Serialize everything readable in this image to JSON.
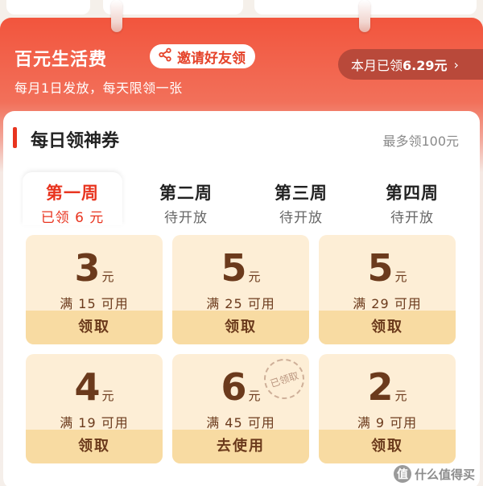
{
  "banner": {
    "title": "百元生活费",
    "invite_label": "邀请好友领",
    "subtitle": "每月1日发放，每天限领一张",
    "monthly_prefix": "本月已领",
    "monthly_amount": "6.29元",
    "monthly_chevron": "›"
  },
  "section": {
    "title": "每日领神券",
    "max_text": "最多领100元"
  },
  "tabs": [
    {
      "label": "第一周",
      "status": "已领 6 元",
      "active": true
    },
    {
      "label": "第二周",
      "status": "待开放",
      "active": false
    },
    {
      "label": "第三周",
      "status": "待开放",
      "active": false
    },
    {
      "label": "第四周",
      "status": "待开放",
      "active": false
    }
  ],
  "coupons": [
    {
      "value": "3",
      "unit": "元",
      "condition": "满 15 可用",
      "action": "领取"
    },
    {
      "value": "5",
      "unit": "元",
      "condition": "满 25 可用",
      "action": "领取"
    },
    {
      "value": "5",
      "unit": "元",
      "condition": "满 29 可用",
      "action": "领取"
    },
    {
      "value": "4",
      "unit": "元",
      "condition": "满 19 可用",
      "action": "领取"
    },
    {
      "value": "6",
      "unit": "元",
      "condition": "满 45 可用",
      "action": "去使用",
      "stamp": "已领取"
    },
    {
      "value": "2",
      "unit": "元",
      "condition": "满 9 可用",
      "action": "领取"
    }
  ],
  "watermark": {
    "logo_char": "值",
    "text": "什么值得买"
  },
  "colors": {
    "accent": "#e8341f",
    "coupon_bg": "#fdeed6",
    "coupon_button": "#f8dba2",
    "coupon_text": "#6b3a1c"
  }
}
